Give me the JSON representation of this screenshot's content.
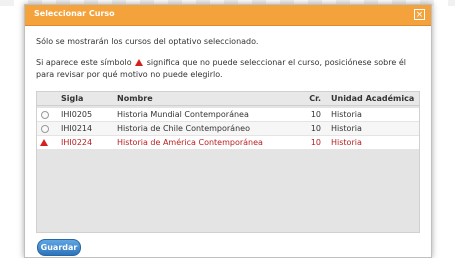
{
  "dialog": {
    "title": "Seleccionar Curso",
    "close_label": "×",
    "info_line1": "Sólo se mostrarán los cursos del optativo seleccionado.",
    "info_line2_pre": "Si aparece este símbolo",
    "info_line2_post": "significa que no puede seleccionar el curso, posiciónese sobre él para revisar por qué motivo no puede elegirlo.",
    "save_label": "Guardar"
  },
  "table": {
    "headers": [
      "Sigla",
      "Nombre",
      "Cr.",
      "Unidad Académica"
    ],
    "rows": [
      {
        "sigla": "IHI0205",
        "nombre": "Historia Mundial Contemporánea",
        "cr": "10",
        "unidad": "Historia",
        "blocked": false
      },
      {
        "sigla": "IHI0214",
        "nombre": "Historia de Chile Contemporáneo",
        "cr": "10",
        "unidad": "Historia",
        "blocked": false
      },
      {
        "sigla": "IHI0224",
        "nombre": "Historia de América Contemporánea",
        "cr": "10",
        "unidad": "Historia",
        "blocked": true
      }
    ]
  },
  "icons": {
    "warning": "warning-triangle-icon",
    "radio": "radio-button-icon",
    "close": "close-icon"
  },
  "colors": {
    "titlebar": "#f4a23b",
    "warning": "#d62020",
    "blocked_text": "#b81f1f",
    "button": "#2e74bd"
  }
}
